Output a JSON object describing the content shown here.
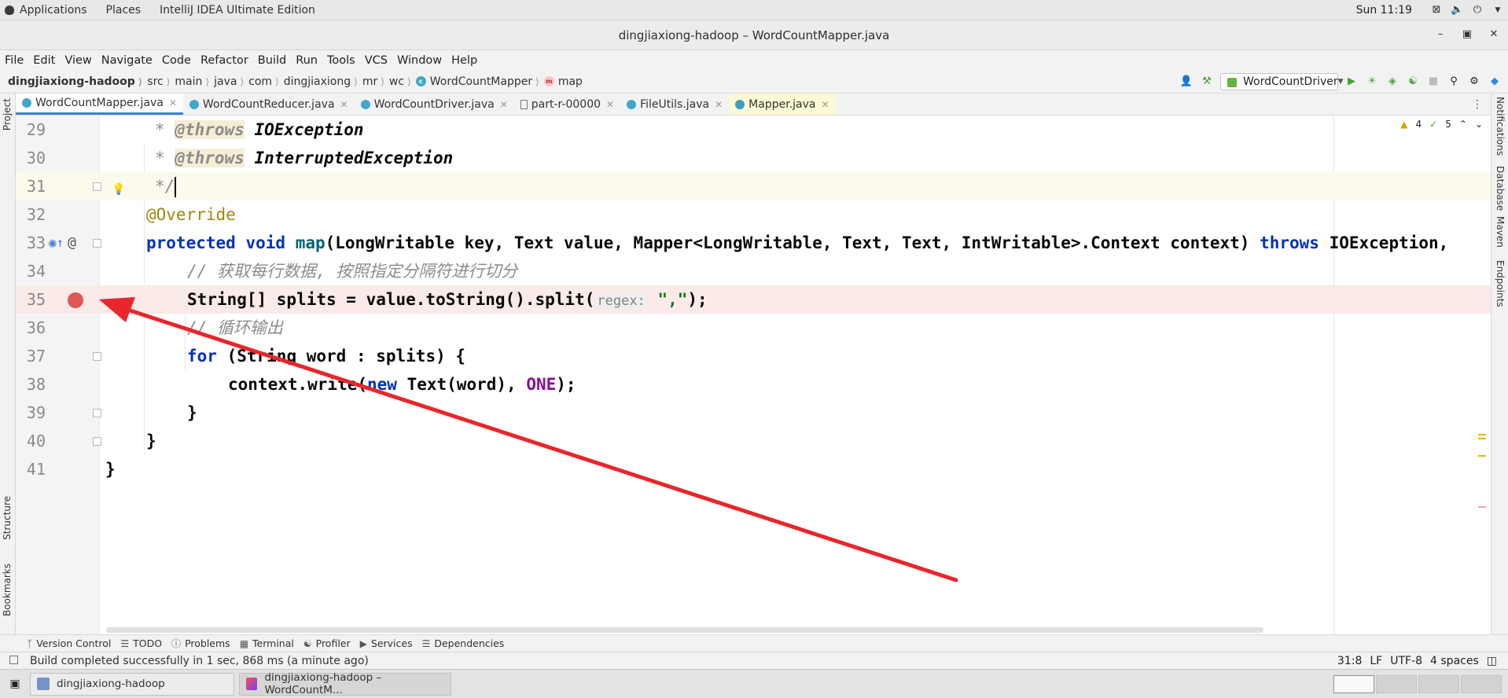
{
  "topbar": {
    "applications": "Applications",
    "places": "Places",
    "app_name": "IntelliJ IDEA Ultimate Edition",
    "clock": "Sun 11:19",
    "icons": [
      "network-icon",
      "volume-icon",
      "power-icon"
    ]
  },
  "window": {
    "title": "dingjiaxiong-hadoop – WordCountMapper.java",
    "controls": [
      "minimize-icon",
      "maximize-icon",
      "close-icon"
    ]
  },
  "menu": {
    "items": [
      "File",
      "Edit",
      "View",
      "Navigate",
      "Code",
      "Refactor",
      "Build",
      "Run",
      "Tools",
      "VCS",
      "Window",
      "Help"
    ]
  },
  "breadcrumb": {
    "items": [
      "dingjiaxiong-hadoop",
      "src",
      "main",
      "java",
      "com",
      "dingjiaxiong",
      "mr",
      "wc",
      "WordCountMapper",
      "map"
    ]
  },
  "run_config": {
    "selected": "WordCountDriver"
  },
  "tabs": [
    {
      "label": "WordCountMapper.java"
    },
    {
      "label": "WordCountReducer.java"
    },
    {
      "label": "WordCountDriver.java"
    },
    {
      "label": "part-r-00000"
    },
    {
      "label": "FileUtils.java"
    },
    {
      "label": "Mapper.java"
    }
  ],
  "left_tool_tabs": [
    "Project",
    "Structure",
    "Bookmarks"
  ],
  "right_tool_tabs": [
    "Notifications",
    "Database",
    "Maven",
    "Endpoints"
  ],
  "inspections": {
    "warnings": "4",
    "checks": "5"
  },
  "editor": {
    "line_numbers": [
      "29",
      "30",
      "31",
      "32",
      "33",
      "34",
      "35",
      "36",
      "37",
      "38",
      "39",
      "40",
      "41"
    ],
    "l29": {
      "star": "* ",
      "tag": "@throws",
      "val": "IOException"
    },
    "l30": {
      "star": "* ",
      "tag": "@throws",
      "val": "InterruptedException"
    },
    "l31": {
      "text": "*/"
    },
    "l32": {
      "text": "@Override"
    },
    "l33": {
      "kw1": "protected",
      "kw2": "void",
      "method": "map",
      "params": "(LongWritable key, Text value, Mapper<LongWritable, Text, Text, IntWritable>.Context context) ",
      "kw3": "throws",
      "rest": " IOException,"
    },
    "l34": {
      "comment": "// 获取每行数据, 按照指定分隔符进行切分"
    },
    "l35": {
      "pre": "String[] splits = value.toString().split(",
      "hint": "regex:",
      "str": "\",\"",
      "post": ");"
    },
    "l36": {
      "comment": "// 循环输出"
    },
    "l37": {
      "kw": "for",
      "rest": " (String word : splits) {"
    },
    "l38": {
      "pre": "context.write(",
      "kw": "new",
      "mid": " Text(word), ",
      "const": "ONE",
      "post": ");"
    },
    "l39": {
      "text": "}"
    },
    "l40": {
      "text": "}"
    },
    "l41": {
      "text": "}"
    }
  },
  "tool_windows": [
    "Version Control",
    "TODO",
    "Problems",
    "Terminal",
    "Profiler",
    "Services",
    "Dependencies"
  ],
  "status": {
    "message": "Build completed successfully in 1 sec, 868 ms (a minute ago)",
    "position": "31:8",
    "line_sep": "LF",
    "encoding": "UTF-8",
    "indent": "4 spaces"
  },
  "taskbar": {
    "items": [
      "dingjiaxiong-hadoop",
      "dingjiaxiong-hadoop – WordCountM..."
    ]
  },
  "annotation": {
    "color": "#e8262b"
  }
}
